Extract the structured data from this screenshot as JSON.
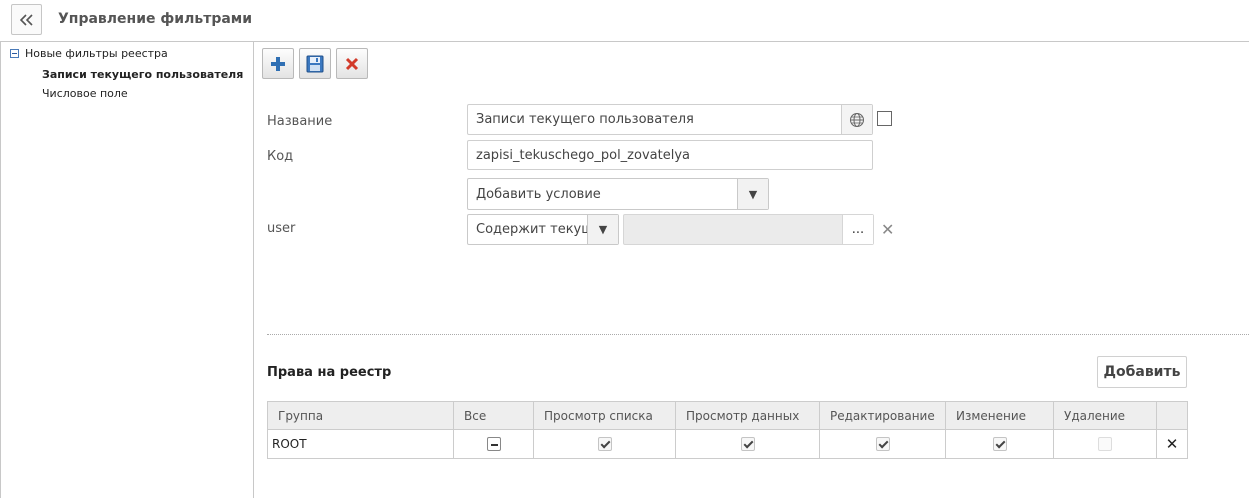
{
  "header": {
    "title": "Управление фильтрами",
    "back_icon": "double-chevron-left-icon"
  },
  "tree": {
    "root_label": "Новые фильтры реестра",
    "items": [
      {
        "label": "Записи текущего пользователя",
        "selected": true
      },
      {
        "label": "Числовое поле",
        "selected": false
      }
    ]
  },
  "toolbar": {
    "add_icon": "plus-icon",
    "save_icon": "floppy-disk-icon",
    "delete_icon": "red-x-icon"
  },
  "form": {
    "name_label": "Название",
    "name_value": "Записи текущего пользователя",
    "code_label": "Код",
    "code_value": "zapisi_tekuschego_pol_zovatelya",
    "add_condition_value": "Добавить условие",
    "condition_field_label": "user",
    "condition_operator_value": "Содержит текущ",
    "dots_label": "..."
  },
  "rights": {
    "title": "Права на реестр",
    "add_button": "Добавить",
    "columns": [
      "Группа",
      "Все",
      "Просмотр списка",
      "Просмотр данных",
      "Редактирование",
      "Изменение",
      "Удаление",
      ""
    ],
    "rows": [
      {
        "group": "ROOT",
        "all": "indeterminate",
        "view_list": true,
        "view_data": true,
        "edit": true,
        "change": true,
        "delete": false
      }
    ]
  }
}
